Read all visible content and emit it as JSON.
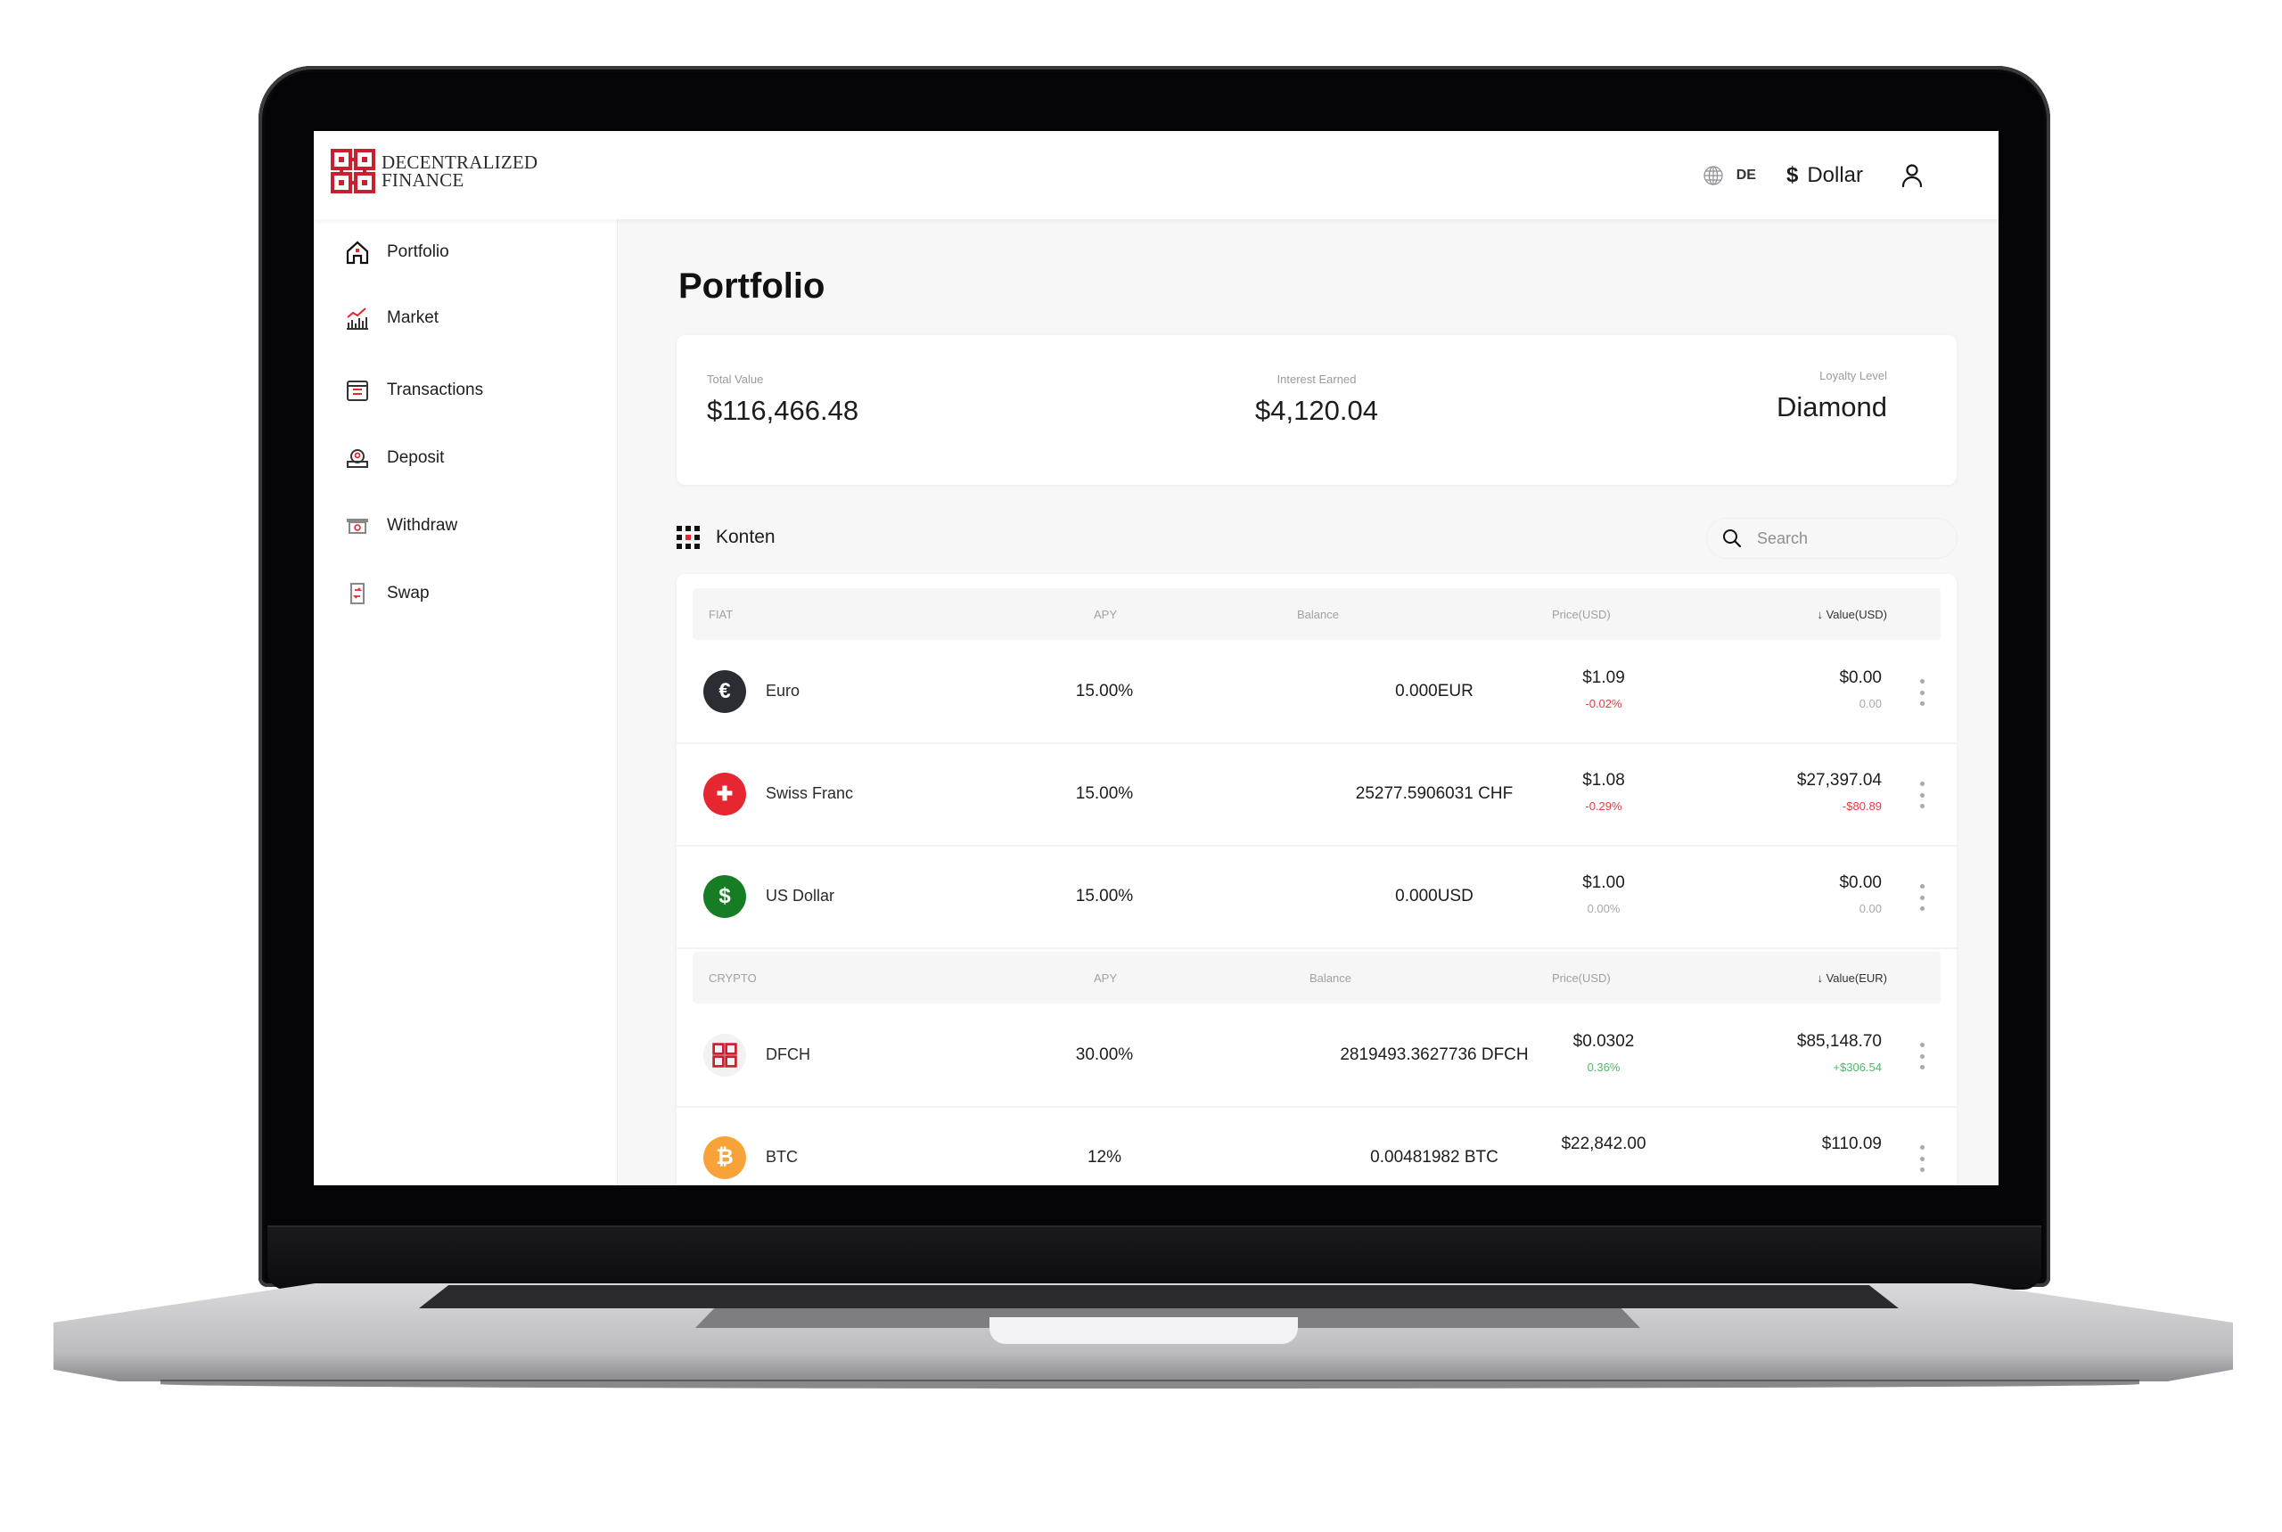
{
  "brand": {
    "line1": "DECENTRALIZED",
    "line2": "FINANCE",
    "accent": "#c8202f"
  },
  "header": {
    "language": "DE",
    "currency_symbol": "$",
    "currency_label": "Dollar",
    "icons": {
      "language": "globe-icon",
      "user": "user-icon"
    }
  },
  "sidebar": {
    "items": [
      {
        "label": "Portfolio",
        "icon": "home-icon"
      },
      {
        "label": "Market",
        "icon": "chart-icon"
      },
      {
        "label": "Transactions",
        "icon": "transactions-icon"
      },
      {
        "label": "Deposit",
        "icon": "deposit-icon"
      },
      {
        "label": "Withdraw",
        "icon": "withdraw-icon"
      },
      {
        "label": "Swap",
        "icon": "swap-icon"
      }
    ]
  },
  "page": {
    "title": "Portfolio"
  },
  "summary": {
    "total_value": {
      "label": "Total Value",
      "value": "$116,466.48"
    },
    "interest_earned": {
      "label": "Interest Earned",
      "value": "$4,120.04"
    },
    "loyalty_level": {
      "label": "Loyalty Level",
      "value": "Diamond"
    }
  },
  "accounts": {
    "title": "Konten",
    "search_placeholder": "Search",
    "fiat": {
      "headers": {
        "name": "FIAT",
        "apy": "APY",
        "balance": "Balance",
        "price": "Price(USD)",
        "value": "↓ Value(USD)"
      },
      "rows": [
        {
          "name": "Euro",
          "icon": "euro-icon",
          "icon_glyph": "€",
          "icon_color": "#2b2d33",
          "apy": "15.00%",
          "balance": "0.000EUR",
          "price": "$1.09",
          "price_change": "-0.02%",
          "price_trend": "neg",
          "value": "$0.00",
          "value_change": "0.00",
          "value_trend": "neu"
        },
        {
          "name": "Swiss Franc",
          "icon": "swiss-franc-icon",
          "icon_glyph": "✚",
          "icon_color": "#e62631",
          "apy": "15.00%",
          "balance": "25277.5906031 CHF",
          "price": "$1.08",
          "price_change": "-0.29%",
          "price_trend": "neg",
          "value": "$27,397.04",
          "value_change": "-$80.89",
          "value_trend": "neg"
        },
        {
          "name": "US Dollar",
          "icon": "us-dollar-icon",
          "icon_glyph": "$",
          "icon_color": "#167d24",
          "apy": "15.00%",
          "balance": "0.000USD",
          "price": "$1.00",
          "price_change": "0.00%",
          "price_trend": "neu",
          "value": "$0.00",
          "value_change": "0.00",
          "value_trend": "neu"
        }
      ]
    },
    "crypto": {
      "headers": {
        "name": "CRYPTO",
        "apy": "APY",
        "balance": "Balance",
        "price": "Price(USD)",
        "value": "↓ Value(EUR)"
      },
      "rows": [
        {
          "name": "DFCH",
          "icon": "dfch-icon",
          "icon_glyph": "",
          "icon_color": "#f2f2f3",
          "apy": "30.00%",
          "balance": "2819493.3627736 DFCH",
          "price": "$0.0302",
          "price_change": "0.36%",
          "price_trend": "pos",
          "value": "$85,148.70",
          "value_change": "+$306.54",
          "value_trend": "pos"
        },
        {
          "name": "BTC",
          "icon": "bitcoin-icon",
          "icon_glyph": "₿",
          "icon_color": "#f7a33a",
          "apy": "12%",
          "balance": "0.00481982 BTC",
          "price": "$22,842.00",
          "price_change": "",
          "price_trend": "neu",
          "value": "$110.09",
          "value_change": "",
          "value_trend": "neu"
        }
      ]
    }
  }
}
